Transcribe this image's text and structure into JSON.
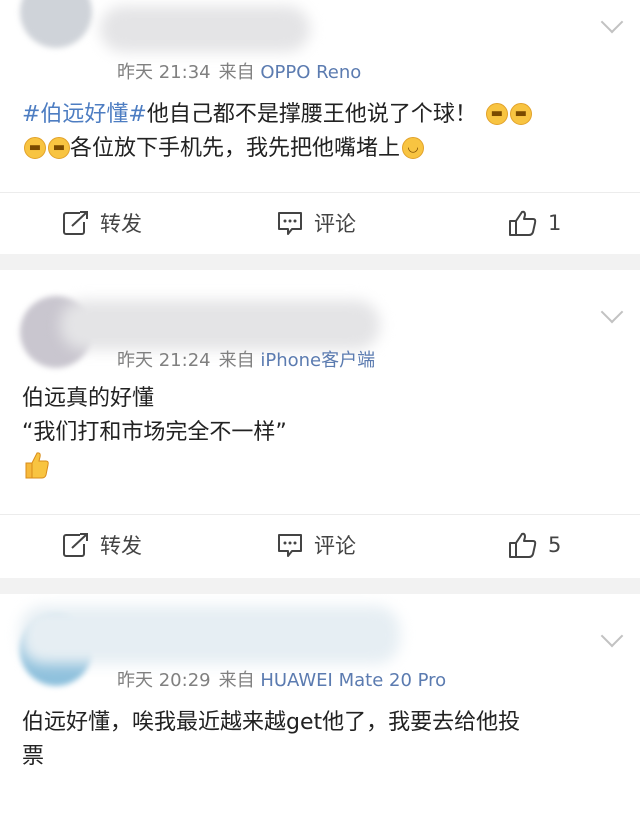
{
  "comments": [
    {
      "time": "昨天 21:34",
      "source_prefix": "来自",
      "source_device": "OPPO Reno",
      "topic": "#伯远好懂#",
      "line1": "他自己都不是撑腰王他说了个球！",
      "line1_emoji": "grin-emoji",
      "line2": "各位放下手机先，我先把他嘴堵上",
      "line2_emoji": "wink-emoji",
      "repost_label": "转发",
      "comment_label": "评论",
      "like_count": "1"
    },
    {
      "time": "昨天 21:24",
      "source_prefix": "来自",
      "source_device": "iPhone客户端",
      "line1": "伯远真的好懂",
      "line2": "“我们打和市场完全不一样”",
      "line3_emoji": "thumbs-up-emoji",
      "repost_label": "转发",
      "comment_label": "评论",
      "like_count": "5"
    },
    {
      "time": "昨天 20:29",
      "source_prefix": "来自",
      "source_device": "HUAWEI Mate 20 Pro",
      "line1": "伯远好懂，唉我最近越来越get他了，我要去给他投",
      "line2": "票"
    }
  ],
  "colors": {
    "topic": "#4d7dc2",
    "source": "#5b7bb0",
    "meta": "#808080",
    "emoji": "#f8c441"
  }
}
